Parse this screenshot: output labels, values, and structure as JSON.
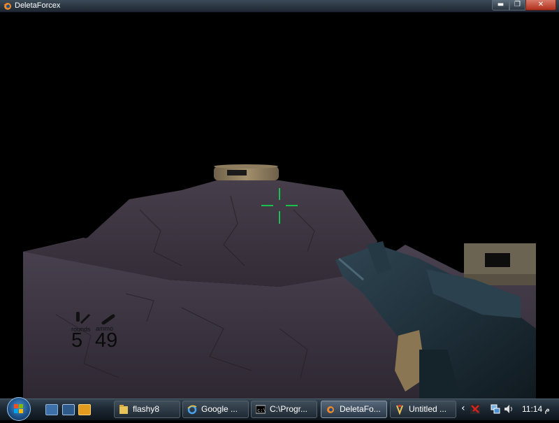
{
  "window": {
    "title": "DeletaForcex",
    "min_label": "▬",
    "max_label": "❐",
    "close_label": "✕"
  },
  "hud": {
    "rounds_label": "rounds",
    "ammo_label": "ammo",
    "rounds_value": "5",
    "ammo_value": "49"
  },
  "taskbar": {
    "quick_launch": [
      "show-desktop-icon",
      "switch-windows-icon",
      "media-player-icon"
    ],
    "tasks": [
      {
        "label": "flashy8",
        "icon": "folder-icon"
      },
      {
        "label": "Google ...",
        "icon": "internet-explorer-icon"
      },
      {
        "label": "C:\\Progr...",
        "icon": "command-prompt-icon"
      },
      {
        "label": "DeletaFo...",
        "icon": "blender-icon"
      },
      {
        "label": "Untitled ...",
        "icon": "paint-icon"
      }
    ],
    "tray": {
      "chevron": "‹",
      "clock": "11:14 م"
    }
  },
  "colors": {
    "crosshair": "#19c24a",
    "terrain": "#3f3844",
    "taskbar": "#1c2833"
  }
}
